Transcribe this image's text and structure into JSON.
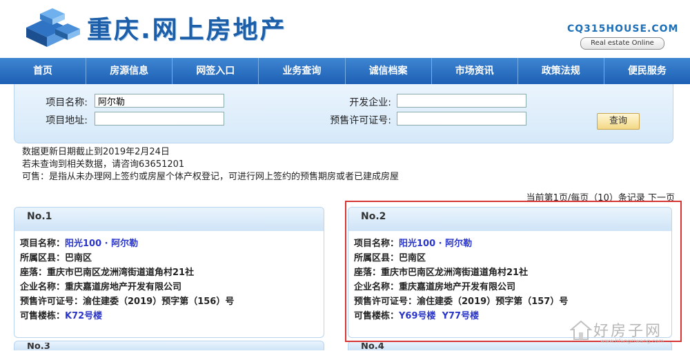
{
  "header": {
    "title": "重庆.网上房地产",
    "brand_code": "CQ315HOUSE.COM",
    "brand_tagline": "Real estate Online"
  },
  "nav": [
    {
      "label": "首页"
    },
    {
      "label": "房源信息"
    },
    {
      "label": "网签入口"
    },
    {
      "label": "业务查询"
    },
    {
      "label": "诚信档案"
    },
    {
      "label": "市场资讯"
    },
    {
      "label": "政策法规"
    },
    {
      "label": "便民服务"
    }
  ],
  "search": {
    "project_name_label": "项目名称:",
    "project_name_value": "阿尔勒",
    "project_addr_label": "项目地址:",
    "project_addr_value": "",
    "developer_label": "开发企业:",
    "developer_value": "",
    "permit_label": "预售许可证号:",
    "permit_value": "",
    "query_label": "查询"
  },
  "notes": {
    "line1": "数据更新日期截止到2019年2月24日",
    "line2": "若未查询到相关数据，请咨询63651201",
    "line3": "可售：是指从未办理网上签约或房屋个体产权登记，可进行网上签约的预售期房或者已建成房屋"
  },
  "pager": {
    "text": "当前第1页/每页（10）条记录",
    "next": "下一页"
  },
  "cards": [
    {
      "no": "No.1",
      "name_label": "项目名称：",
      "name_value": "阳光100 · 阿尔勒",
      "district_label": "所属区县：",
      "district_value": "巴南区",
      "addr_label": "座落：",
      "addr_value": "重庆市巴南区龙洲湾街道道角村21社",
      "company_label": "企业名称：",
      "company_value": "重庆嘉道房地产开发有限公司",
      "permit_label": "预售许可证号：",
      "permit_value": "渝住建委（2019）预字第（156）号",
      "buildings_label": "可售楼栋：",
      "buildings": [
        "K72号楼"
      ]
    },
    {
      "no": "No.2",
      "name_label": "项目名称：",
      "name_value": "阳光100 · 阿尔勒",
      "district_label": "所属区县：",
      "district_value": "巴南区",
      "addr_label": "座落：",
      "addr_value": "重庆市巴南区龙洲湾街道道角村21社",
      "company_label": "企业名称：",
      "company_value": "重庆嘉道房地产开发有限公司",
      "permit_label": "预售许可证号：",
      "permit_value": "渝住建委（2019）预字第（157）号",
      "buildings_label": "可售楼栋：",
      "buildings": [
        "Y69号楼",
        "Y77号楼"
      ]
    }
  ],
  "cards_next": [
    {
      "no": "No.3"
    },
    {
      "no": "No.4"
    }
  ],
  "watermark": {
    "text": "好房子网",
    "url": "www.hfangziwang.com"
  }
}
